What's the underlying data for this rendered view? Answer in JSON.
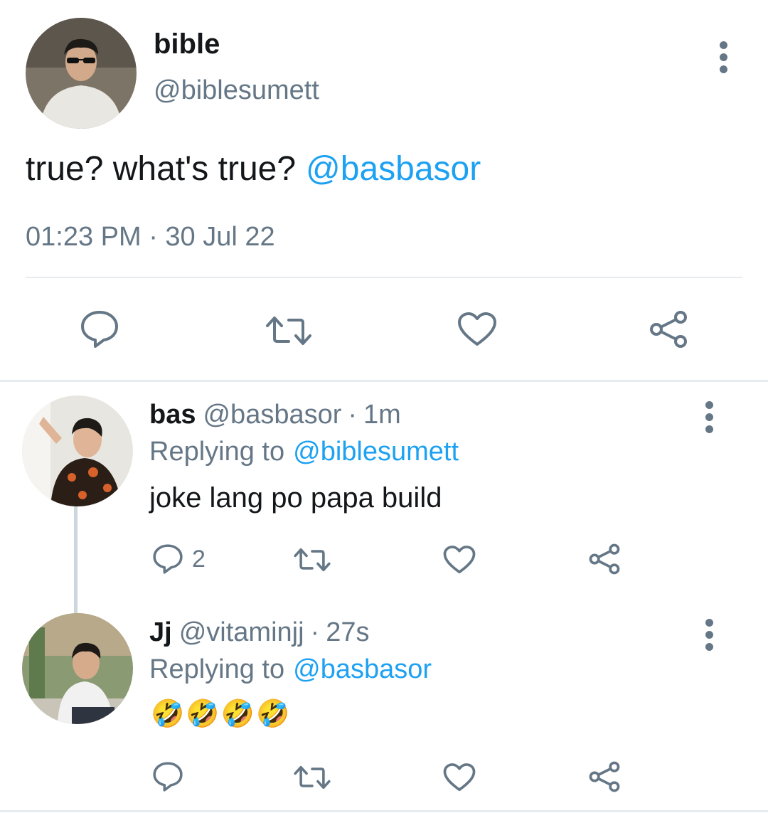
{
  "main_tweet": {
    "display_name": "bible",
    "handle": "@biblesumett",
    "text": "true? what's true?",
    "mention": "@basbasor",
    "timestamp": "01:23 PM · 30 Jul 22",
    "more_icon": "more-vertical-icon",
    "actions": [
      "reply-icon",
      "retweet-icon",
      "like-icon",
      "share-icon"
    ]
  },
  "replies": [
    {
      "display_name": "bas",
      "handle": "@basbasor",
      "separator": "·",
      "time": "1m",
      "replying_label": "Replying to",
      "replying_to": "@biblesumett",
      "text": "joke lang po papa build",
      "reply_count": "2"
    },
    {
      "display_name": "Jj",
      "handle": "@vitaminjj",
      "separator": "·",
      "time": "27s",
      "replying_label": "Replying to",
      "replying_to": "@basbasor",
      "text": "🤣🤣🤣🤣",
      "reply_count": ""
    }
  ],
  "colors": {
    "accent": "#1da1f2",
    "muted": "#657786",
    "text": "#14171a",
    "divider": "#e6ecf0"
  }
}
